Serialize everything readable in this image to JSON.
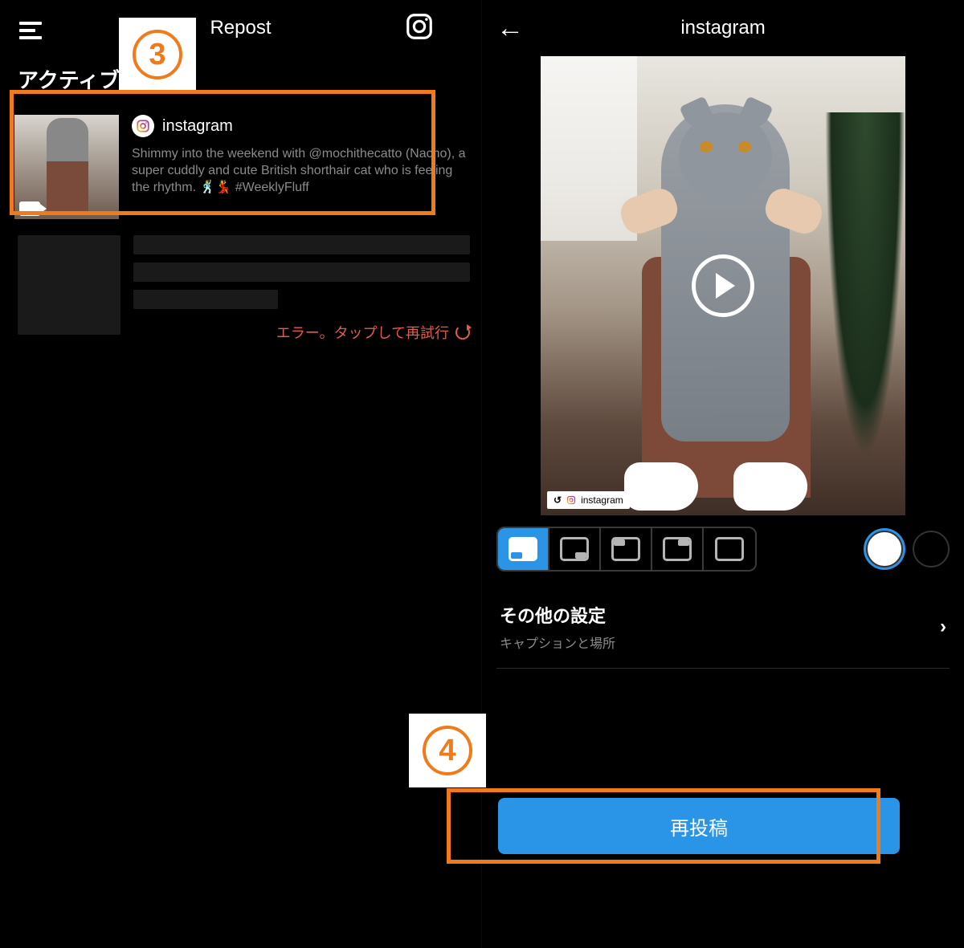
{
  "left": {
    "header": {
      "title": "Repost"
    },
    "section_label": "アクティブ",
    "post": {
      "author": "instagram",
      "caption": "Shimmy into the weekend with @mochithecatto (Nacho), a super cuddly and cute British shorthair cat who is feeling the rhythm. 🕺💃 #WeeklyFluff"
    },
    "error_text": "エラー。タップして再試行"
  },
  "right": {
    "header": {
      "title": "instagram"
    },
    "repost_tag": "instagram",
    "settings": {
      "title": "その他の設定",
      "subtitle": "キャプションと場所"
    },
    "repost_button_label": "再投稿"
  },
  "steps": {
    "s3": "3",
    "s4": "4"
  },
  "colors": {
    "accent": "#f17a1a",
    "primary_blue": "#2a94e6",
    "error": "#e65a4d"
  }
}
